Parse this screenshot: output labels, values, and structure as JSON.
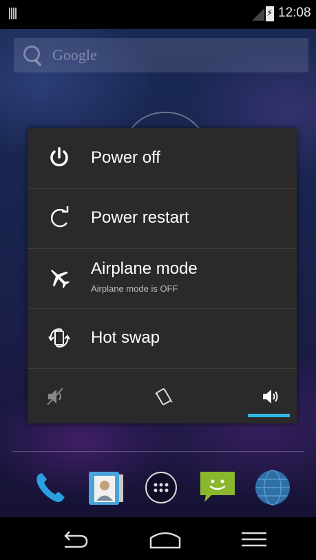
{
  "status_bar": {
    "time": "12:08",
    "icons": [
      "notification-icon",
      "signal-icon",
      "battery-charging-icon"
    ]
  },
  "search": {
    "placeholder": "Google",
    "icon": "search-icon"
  },
  "power_menu": {
    "items": [
      {
        "icon": "power-icon",
        "label": "Power off"
      },
      {
        "icon": "restart-icon",
        "label": "Power restart"
      },
      {
        "icon": "airplane-icon",
        "label": "Airplane mode",
        "sublabel": "Airplane mode is OFF"
      },
      {
        "icon": "hot-swap-icon",
        "label": "Hot swap"
      }
    ],
    "sound_modes": [
      {
        "icon": "mute-icon",
        "selected": false
      },
      {
        "icon": "vibrate-icon",
        "selected": false
      },
      {
        "icon": "sound-on-icon",
        "selected": true
      }
    ],
    "accent_color": "#33b5e5"
  },
  "dock": {
    "icons": [
      "phone-icon",
      "contacts-icon",
      "app-drawer-icon",
      "messaging-icon",
      "browser-icon"
    ]
  },
  "nav_bar": {
    "buttons": [
      "back-icon",
      "home-icon",
      "menu-icon"
    ]
  }
}
